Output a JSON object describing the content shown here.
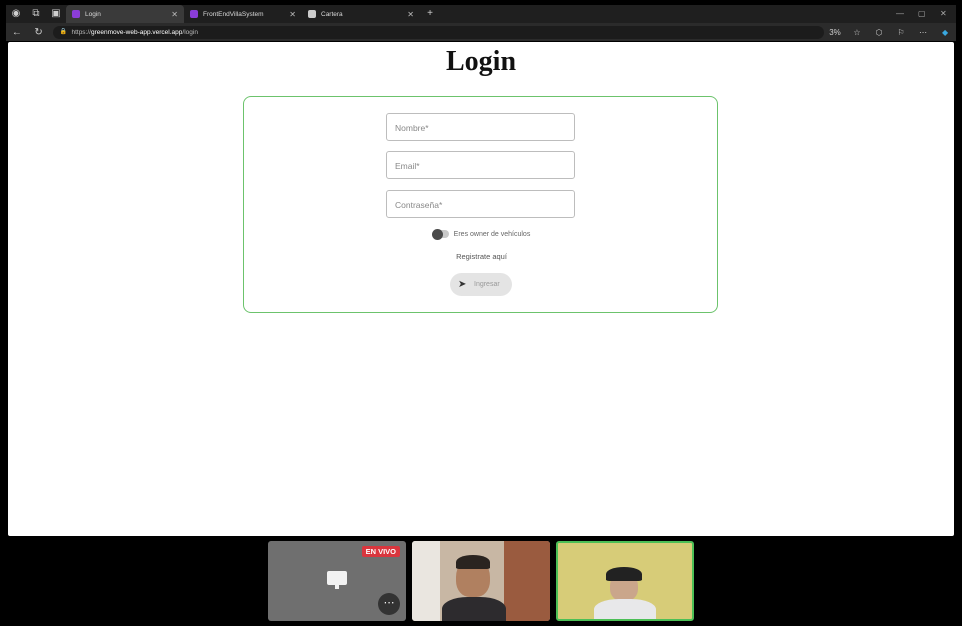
{
  "browser": {
    "tabs": [
      {
        "title": "Login",
        "favicon_color": "#8b3dd8",
        "active": true
      },
      {
        "title": "FrontEndVillaSystem",
        "favicon_color": "#8b3dd8",
        "active": false
      },
      {
        "title": "Cartera",
        "favicon_color": "#cccccc",
        "active": false
      }
    ],
    "url_prefix": "https://",
    "url_host": "greenmove-web-app.vercel.app",
    "url_path": "/login",
    "zoom": "3%"
  },
  "page": {
    "title": "Login",
    "form": {
      "name_placeholder": "Nombre*",
      "email_placeholder": "Email*",
      "password_placeholder": "Contraseña*",
      "owner_toggle_label": "Eres owner de vehículos",
      "register_link": "Registrate aquí",
      "submit_label": "Ingresar"
    },
    "accent_color": "#6cc36c"
  },
  "meeting": {
    "live_badge": "EN VIVO",
    "live_color": "#d9363e"
  }
}
